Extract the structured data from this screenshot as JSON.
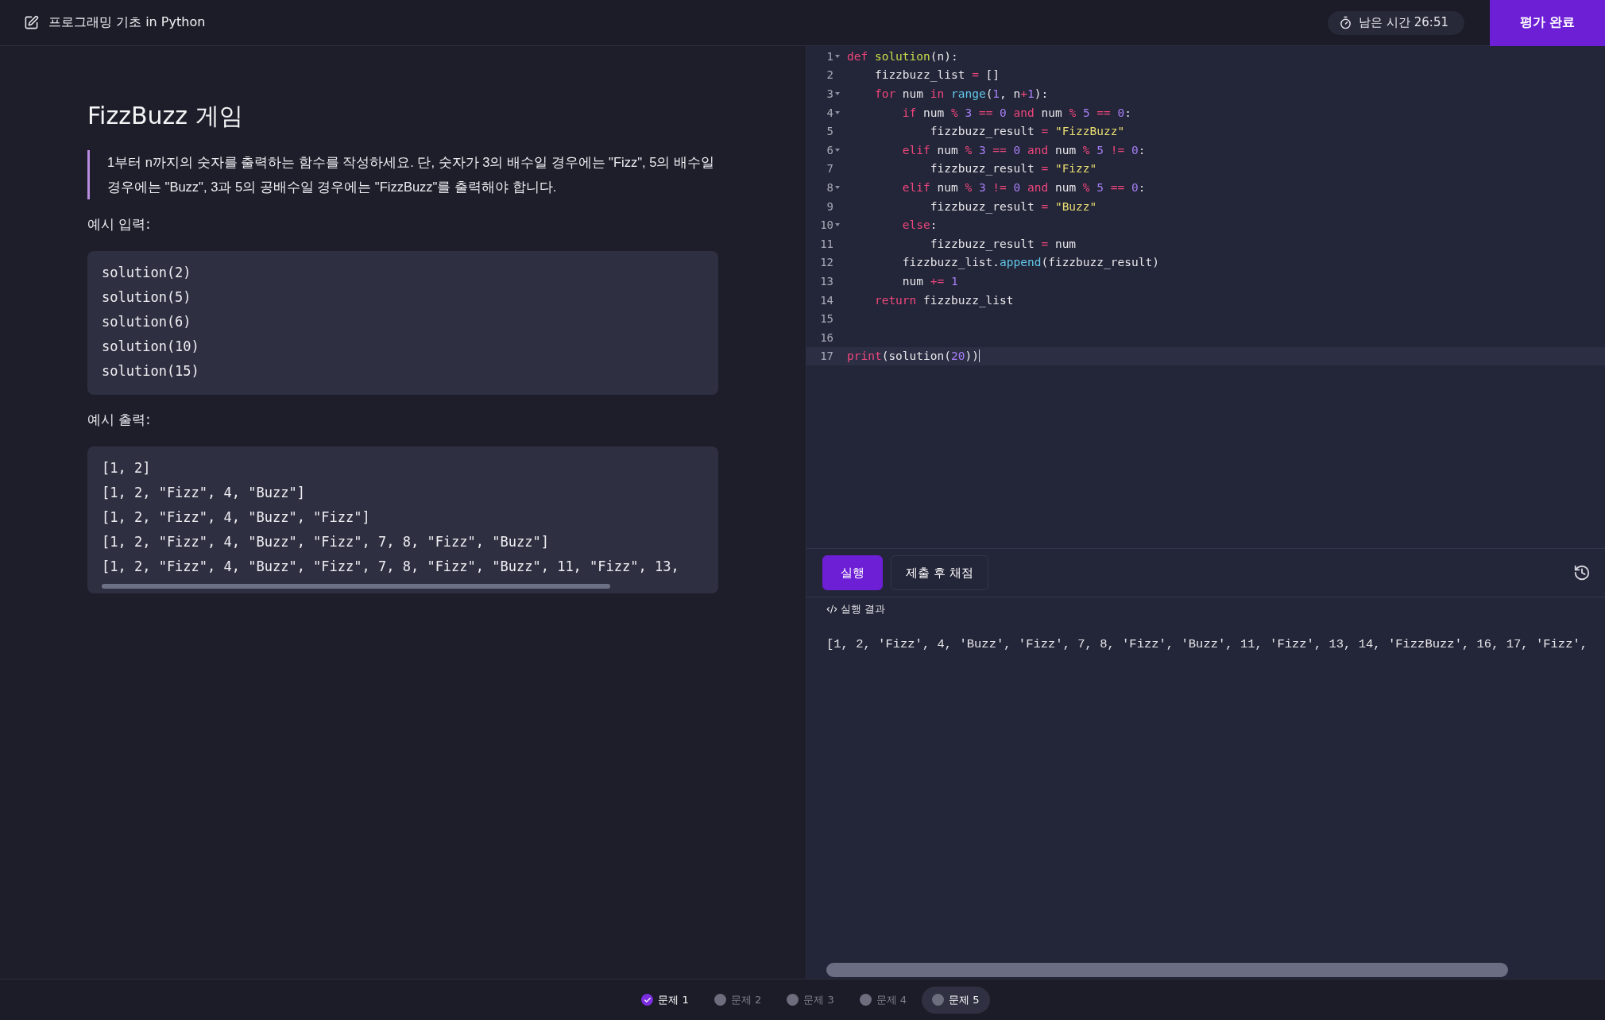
{
  "header": {
    "title": "프로그래밍 기초 in Python",
    "timer": "남은 시간 26:51",
    "finish_button": "평가 완료"
  },
  "problem": {
    "title": "FizzBuzz 게임",
    "description": "1부터 n까지의 숫자를 출력하는 함수를 작성하세요. 단, 숫자가 3의 배수일 경우에는 \"Fizz\", 5의 배수일 경우에는 \"Buzz\", 3과 5의 공배수일 경우에는 \"FizzBuzz\"를 출력해야 합니다.",
    "input_label": "예시 입력:",
    "input_lines": [
      "solution(2)",
      "solution(5)",
      "solution(6)",
      "solution(10)",
      "solution(15)"
    ],
    "output_label": "예시 출력:",
    "output_lines": [
      "[1, 2]",
      "[1, 2, \"Fizz\", 4, \"Buzz\"]",
      "[1, 2, \"Fizz\", 4, \"Buzz\", \"Fizz\"]",
      "[1, 2, \"Fizz\", 4, \"Buzz\", \"Fizz\", 7, 8, \"Fizz\", \"Buzz\"]",
      "[1, 2, \"Fizz\", 4, \"Buzz\", \"Fizz\", 7, 8, \"Fizz\", \"Buzz\", 11, \"Fizz\", 13,"
    ]
  },
  "editor": {
    "lines": [
      {
        "number": "1",
        "fold": true,
        "current": false,
        "tokens": [
          {
            "text": "def",
            "kind": "keyword"
          },
          {
            "text": " solution",
            "kind": "function"
          },
          {
            "text": "(n):",
            "kind": "plain"
          }
        ]
      },
      {
        "number": "2",
        "fold": false,
        "current": false,
        "tokens": [
          {
            "text": "    fizzbuzz_list",
            "kind": "plain"
          },
          {
            "text": " =",
            "kind": "operator"
          },
          {
            "text": " []",
            "kind": "plain"
          }
        ]
      },
      {
        "number": "3",
        "fold": true,
        "current": false,
        "tokens": [
          {
            "text": "    for",
            "kind": "keyword"
          },
          {
            "text": " num",
            "kind": "plain"
          },
          {
            "text": " in",
            "kind": "keyword"
          },
          {
            "text": " range",
            "kind": "builtin"
          },
          {
            "text": "(",
            "kind": "plain"
          },
          {
            "text": "1",
            "kind": "number"
          },
          {
            "text": ", n",
            "kind": "plain"
          },
          {
            "text": "+",
            "kind": "operator"
          },
          {
            "text": "1",
            "kind": "number"
          },
          {
            "text": "):",
            "kind": "plain"
          }
        ]
      },
      {
        "number": "4",
        "fold": true,
        "current": false,
        "tokens": [
          {
            "text": "        if",
            "kind": "keyword"
          },
          {
            "text": " num",
            "kind": "plain"
          },
          {
            "text": " %",
            "kind": "operator"
          },
          {
            "text": " 3",
            "kind": "number"
          },
          {
            "text": " ==",
            "kind": "operator"
          },
          {
            "text": " 0",
            "kind": "number"
          },
          {
            "text": " and",
            "kind": "keyword"
          },
          {
            "text": " num",
            "kind": "plain"
          },
          {
            "text": " %",
            "kind": "operator"
          },
          {
            "text": " 5",
            "kind": "number"
          },
          {
            "text": " ==",
            "kind": "operator"
          },
          {
            "text": " 0",
            "kind": "number"
          },
          {
            "text": ":",
            "kind": "plain"
          }
        ]
      },
      {
        "number": "5",
        "fold": false,
        "current": false,
        "tokens": [
          {
            "text": "            fizzbuzz_result",
            "kind": "plain"
          },
          {
            "text": " =",
            "kind": "operator"
          },
          {
            "text": " \"FizzBuzz\"",
            "kind": "string"
          }
        ]
      },
      {
        "number": "6",
        "fold": true,
        "current": false,
        "tokens": [
          {
            "text": "        elif",
            "kind": "keyword"
          },
          {
            "text": " num",
            "kind": "plain"
          },
          {
            "text": " %",
            "kind": "operator"
          },
          {
            "text": " 3",
            "kind": "number"
          },
          {
            "text": " ==",
            "kind": "operator"
          },
          {
            "text": " 0",
            "kind": "number"
          },
          {
            "text": " and",
            "kind": "keyword"
          },
          {
            "text": " num",
            "kind": "plain"
          },
          {
            "text": " %",
            "kind": "operator"
          },
          {
            "text": " 5",
            "kind": "number"
          },
          {
            "text": " !=",
            "kind": "operator"
          },
          {
            "text": " 0",
            "kind": "number"
          },
          {
            "text": ":",
            "kind": "plain"
          }
        ]
      },
      {
        "number": "7",
        "fold": false,
        "current": false,
        "tokens": [
          {
            "text": "            fizzbuzz_result",
            "kind": "plain"
          },
          {
            "text": " =",
            "kind": "operator"
          },
          {
            "text": " \"Fizz\"",
            "kind": "string"
          }
        ]
      },
      {
        "number": "8",
        "fold": true,
        "current": false,
        "tokens": [
          {
            "text": "        elif",
            "kind": "keyword"
          },
          {
            "text": " num",
            "kind": "plain"
          },
          {
            "text": " %",
            "kind": "operator"
          },
          {
            "text": " 3",
            "kind": "number"
          },
          {
            "text": " !=",
            "kind": "operator"
          },
          {
            "text": " 0",
            "kind": "number"
          },
          {
            "text": " and",
            "kind": "keyword"
          },
          {
            "text": " num",
            "kind": "plain"
          },
          {
            "text": " %",
            "kind": "operator"
          },
          {
            "text": " 5",
            "kind": "number"
          },
          {
            "text": " ==",
            "kind": "operator"
          },
          {
            "text": " 0",
            "kind": "number"
          },
          {
            "text": ":",
            "kind": "plain"
          }
        ]
      },
      {
        "number": "9",
        "fold": false,
        "current": false,
        "tokens": [
          {
            "text": "            fizzbuzz_result",
            "kind": "plain"
          },
          {
            "text": " =",
            "kind": "operator"
          },
          {
            "text": " \"Buzz\"",
            "kind": "string"
          }
        ]
      },
      {
        "number": "10",
        "fold": true,
        "current": false,
        "tokens": [
          {
            "text": "        else",
            "kind": "keyword"
          },
          {
            "text": ":",
            "kind": "plain"
          }
        ]
      },
      {
        "number": "11",
        "fold": false,
        "current": false,
        "tokens": [
          {
            "text": "            fizzbuzz_result",
            "kind": "plain"
          },
          {
            "text": " =",
            "kind": "operator"
          },
          {
            "text": " num",
            "kind": "plain"
          }
        ]
      },
      {
        "number": "12",
        "fold": false,
        "current": false,
        "tokens": [
          {
            "text": "        fizzbuzz_list.",
            "kind": "plain"
          },
          {
            "text": "append",
            "kind": "builtin"
          },
          {
            "text": "(fizzbuzz_result)",
            "kind": "plain"
          }
        ]
      },
      {
        "number": "13",
        "fold": false,
        "current": false,
        "tokens": [
          {
            "text": "        num",
            "kind": "plain"
          },
          {
            "text": " +=",
            "kind": "operator"
          },
          {
            "text": " 1",
            "kind": "number"
          }
        ]
      },
      {
        "number": "14",
        "fold": false,
        "current": false,
        "tokens": [
          {
            "text": "    return",
            "kind": "keyword"
          },
          {
            "text": " fizzbuzz_list",
            "kind": "plain"
          }
        ]
      },
      {
        "number": "15",
        "fold": false,
        "current": false
      },
      {
        "number": "16",
        "fold": false,
        "current": false
      },
      {
        "number": "17",
        "fold": false,
        "current": true,
        "tokens": [
          {
            "text": "print",
            "kind": "keyword"
          },
          {
            "text": "(solution(",
            "kind": "plain"
          },
          {
            "text": "20",
            "kind": "number"
          },
          {
            "text": "))",
            "kind": "plain"
          }
        ]
      }
    ]
  },
  "run_bar": {
    "buttons": [
      {
        "label": "실행",
        "kind": "primary"
      },
      {
        "label": "제출 후 채점",
        "kind": "outline"
      }
    ]
  },
  "result": {
    "label": "실행 결과",
    "output": "[1, 2, 'Fizz', 4, 'Buzz', 'Fizz', 7, 8, 'Fizz', 'Buzz', 11, 'Fizz', 13, 14, 'FizzBuzz', 16, 17, 'Fizz',"
  },
  "problem_tabs": [
    {
      "label": "문제 1",
      "done": true,
      "selected": false
    },
    {
      "label": "문제 2",
      "done": false,
      "selected": false
    },
    {
      "label": "문제 3",
      "done": false,
      "selected": false
    },
    {
      "label": "문제 4",
      "done": false,
      "selected": false
    },
    {
      "label": "문제 5",
      "done": false,
      "selected": true
    }
  ]
}
